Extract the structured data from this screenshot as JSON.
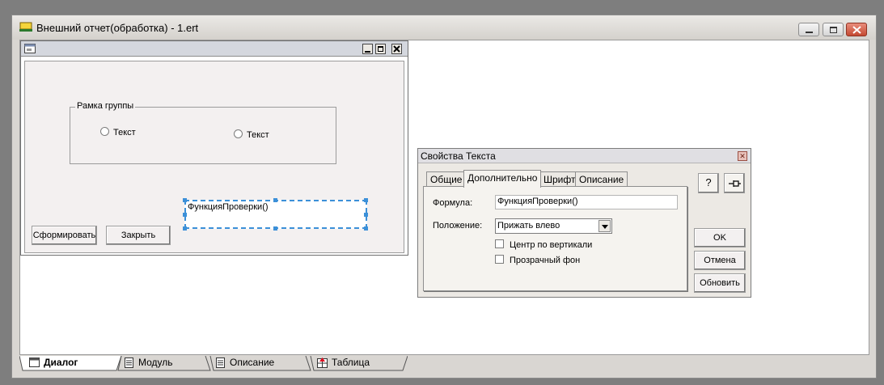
{
  "window": {
    "title": "Внешний отчет(обработка) - 1.ert"
  },
  "form": {
    "groupbox_label": "Рамка группы",
    "radio1_label": "Текст",
    "radio2_label": "Текст",
    "selected_text": "ФункцияПроверки()",
    "btn_generate": "Сформировать",
    "btn_close": "Закрыть"
  },
  "props": {
    "title": "Свойства Текста",
    "tabs": [
      "Общие",
      "Дополнительно",
      "Шрифт",
      "Описание"
    ],
    "formula_label": "Формула:",
    "formula_value": "ФункцияПроверки()",
    "position_label": "Положение:",
    "position_value": "Прижать влево",
    "chk_center": "Центр по вертикали",
    "chk_transparent": "Прозрачный фон",
    "btn_ok": "OK",
    "btn_cancel": "Отмена",
    "btn_refresh": "Обновить",
    "help_icon": "question-mark-icon",
    "pin_icon": "pin-icon"
  },
  "bottom_tabs": [
    "Диалог",
    "Модуль",
    "Описание",
    "Таблица"
  ],
  "colors": {
    "selection": "#3c90d8",
    "close_button": "#c44a32"
  }
}
